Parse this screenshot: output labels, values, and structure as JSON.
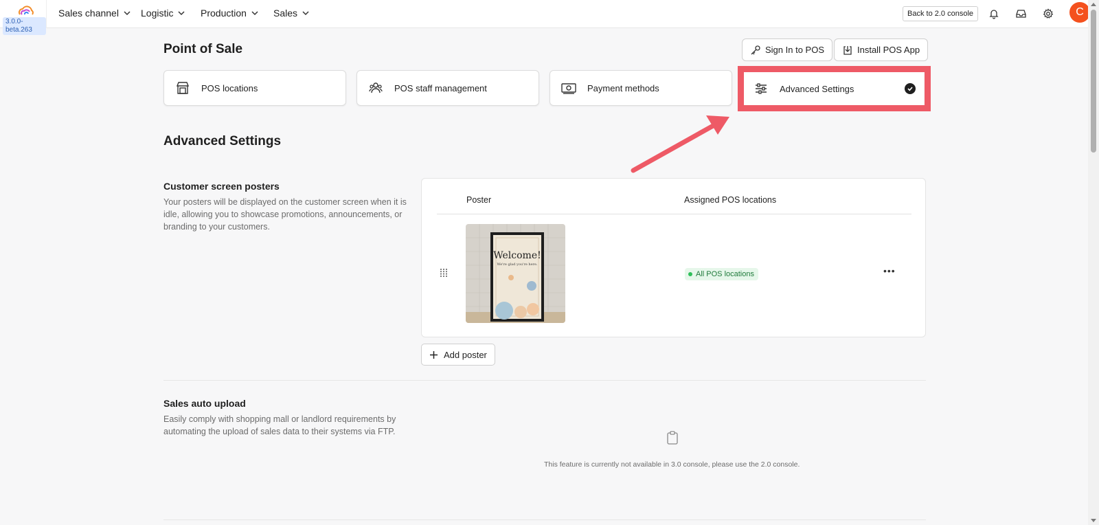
{
  "app": {
    "version": "3.0.0-beta.263",
    "nav": [
      "Sales channel",
      "Logistic",
      "Production",
      "Sales"
    ],
    "back_button": "Back to 2.0 console",
    "avatar_initial": "C",
    "icons": [
      "bell-icon",
      "inbox-icon",
      "gear-icon"
    ]
  },
  "header": {
    "title": "Point of Sale",
    "sign_in_button": "Sign In to POS",
    "install_button": "Install POS App"
  },
  "tabs": [
    {
      "label": "POS locations",
      "icon": "store-icon"
    },
    {
      "label": "POS staff management",
      "icon": "users-icon"
    },
    {
      "label": "Payment methods",
      "icon": "cash-icon"
    },
    {
      "label": "Advanced Settings",
      "icon": "sliders-icon",
      "active": true
    }
  ],
  "annotation": {
    "highlight_color": "#ee5a66"
  },
  "main": {
    "title": "Advanced Settings",
    "posters_section": {
      "title": "Customer screen posters",
      "description": "Your posters will be displayed on the customer screen when it is idle, allowing you to showcase promotions, announcements, or branding to your customers.",
      "columns": [
        "Poster",
        "Assigned POS locations"
      ],
      "rows": [
        {
          "poster_text": "Welcome!",
          "poster_subtext": "We're glad you're here.",
          "location_badge": "All POS locations"
        }
      ],
      "add_button": "Add poster"
    },
    "sales_upload_section": {
      "title": "Sales auto upload",
      "description": "Easily comply with shopping mall or landlord requirements by automating the upload of sales data to their systems via FTP.",
      "unavailable_text": "This feature is currently not available in 3.0 console, please use the 2.0 console."
    }
  }
}
